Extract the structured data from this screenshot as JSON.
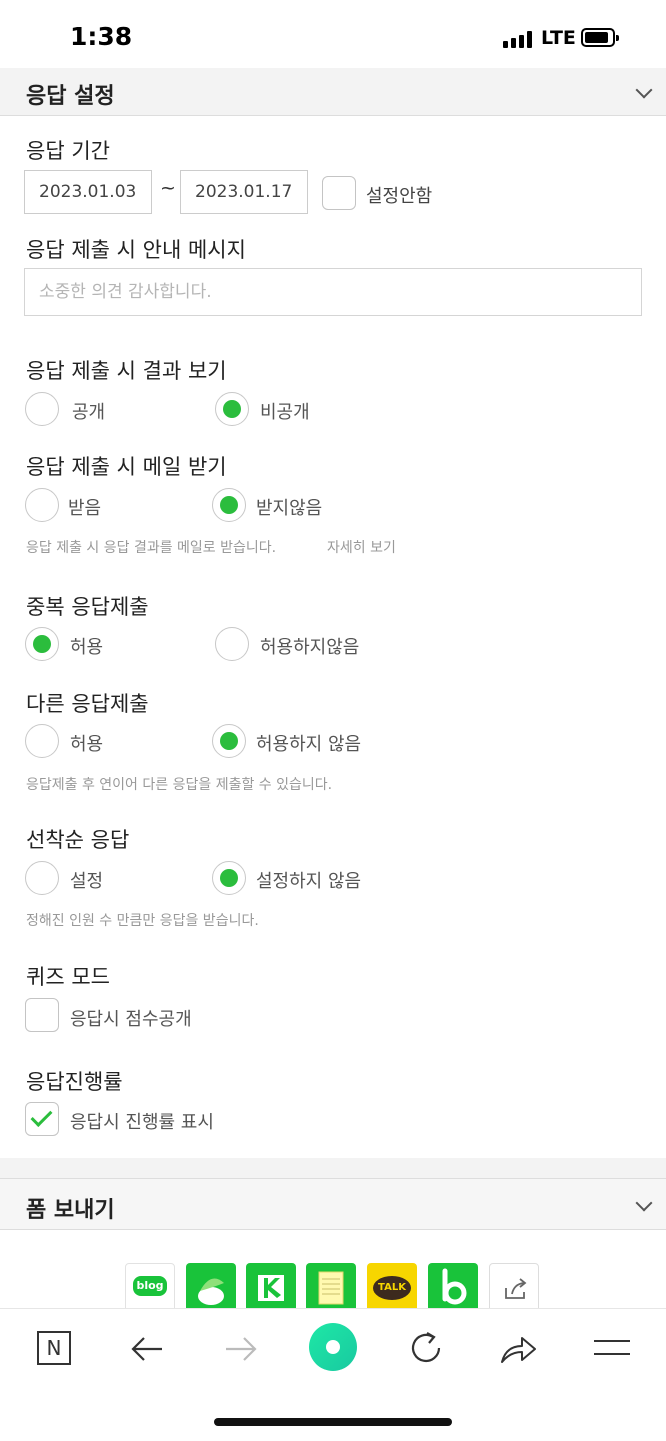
{
  "status_bar": {
    "time": "1:38",
    "network": "LTE"
  },
  "response_settings": {
    "title": "응답 설정",
    "period": {
      "label": "응답 기간",
      "start": "2023.01.03",
      "separator": "~",
      "end": "2023.01.17",
      "no_setting_label": "설정안함"
    },
    "submit_message": {
      "label": "응답 제출 시 안내 메시지",
      "placeholder": "소중한 의견 감사합니다."
    },
    "show_results": {
      "label": "응답 제출 시 결과 보기",
      "options": [
        "공개",
        "비공개"
      ],
      "selected": "비공개"
    },
    "receive_mail": {
      "label": "응답 제출 시 메일 받기",
      "options": [
        "받음",
        "받지않음"
      ],
      "selected": "받지않음",
      "help": "응답 제출 시 응답 결과를 메일로 받습니다.",
      "help_link": "자세히 보기"
    },
    "duplicate": {
      "label": "중복 응답제출",
      "options": [
        "허용",
        "허용하지않음"
      ],
      "selected": "허용"
    },
    "another": {
      "label": "다른 응답제출",
      "options": [
        "허용",
        "허용하지 않음"
      ],
      "selected": "허용하지 않음",
      "help": "응답제출 후 연이어 다른 응답을 제출할 수 있습니다."
    },
    "first_come": {
      "label": "선착순 응답",
      "options": [
        "설정",
        "설정하지 않음"
      ],
      "selected": "설정하지 않음",
      "help": "정해진 인원 수 만큼만 응답을 받습니다."
    },
    "quiz": {
      "label": "퀴즈 모드",
      "checkbox_label": "응답시 점수공개",
      "checked": false
    },
    "progress": {
      "label": "응답진행률",
      "checkbox_label": "응답시 진행률 표시",
      "checked": true
    }
  },
  "send_form": {
    "title": "폼 보내기",
    "share_targets": [
      {
        "icon": "blog-icon",
        "label": "blog",
        "color": "#19c33a"
      },
      {
        "icon": "cafe-icon",
        "color": "#19c33a"
      },
      {
        "icon": "band-icon",
        "color": "#19c33a"
      },
      {
        "icon": "memo-icon",
        "color": "#19c33a"
      },
      {
        "icon": "kakaotalk-icon",
        "label": "TALK",
        "color": "#f7d600"
      },
      {
        "icon": "naver-b-icon",
        "color": "#19c33a"
      },
      {
        "icon": "share-out-icon"
      }
    ]
  },
  "toolbar": {
    "items": [
      "naver-home-icon",
      "back-arrow-icon",
      "forward-arrow-icon",
      "green-dot-icon",
      "reload-icon",
      "share-icon",
      "menu-icon"
    ],
    "accent": "#19d99a"
  }
}
